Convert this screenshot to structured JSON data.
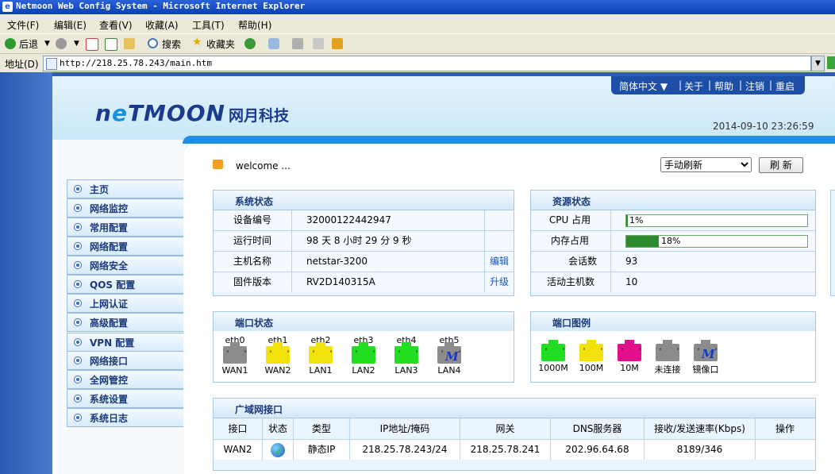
{
  "window": {
    "title": "Netmoon Web Config System - Microsoft Internet Explorer"
  },
  "menu": [
    "文件(F)",
    "编辑(E)",
    "查看(V)",
    "收藏(A)",
    "工具(T)",
    "帮助(H)"
  ],
  "toolbar": {
    "back": "后退",
    "search": "搜索",
    "favorites": "收藏夹"
  },
  "address": {
    "label": "地址(D)",
    "url": "http://218.25.78.243/main.htm"
  },
  "brand": {
    "logo_en_a": "n",
    "logo_en_b": "e",
    "logo_en_c": "TMOON",
    "logo_cn": "网月科技"
  },
  "topnav": [
    "简体中文 ▼",
    "关于",
    "帮助",
    "注销",
    "重启"
  ],
  "datetime": "2014-09-10 23:26:59",
  "welcome": "welcome ...",
  "refresh": {
    "mode": "手动刷新",
    "button": "刷 新"
  },
  "sidebar": [
    "主页",
    "网络监控",
    "常用配置",
    "网络配置",
    "网络安全",
    "QOS 配置",
    "上网认证",
    "高级配置",
    "VPN 配置",
    "网络接口",
    "全网管控",
    "系统设置",
    "系统日志"
  ],
  "system_status": {
    "title": "系统状态",
    "rows": [
      {
        "label": "设备编号",
        "value": "32000122442947",
        "action": ""
      },
      {
        "label": "运行时间",
        "value": "98 天  8 小时  29 分  9 秒",
        "action": ""
      },
      {
        "label": "主机名称",
        "value": "netstar-3200",
        "action": "编辑"
      },
      {
        "label": "固件版本",
        "value": "RV2D140315A",
        "action": "升级"
      }
    ]
  },
  "resource_status": {
    "title": "资源状态",
    "cpu": {
      "label": "CPU 占用",
      "percent": 1,
      "text": "1%"
    },
    "mem": {
      "label": "内存占用",
      "percent": 18,
      "text": "18%"
    },
    "sessions": {
      "label": "会话数",
      "value": "93"
    },
    "hosts": {
      "label": "活动主机数",
      "value": "10"
    }
  },
  "port_status": {
    "title": "端口状态",
    "ports": [
      {
        "name": "eth0",
        "role": "WAN1",
        "state": "未连接",
        "color": "#8c8c8c"
      },
      {
        "name": "eth1",
        "role": "WAN2",
        "state": "100M",
        "color": "#f0e20a"
      },
      {
        "name": "eth2",
        "role": "LAN1",
        "state": "100M",
        "color": "#f0e20a"
      },
      {
        "name": "eth3",
        "role": "LAN2",
        "state": "1000M",
        "color": "#22dd22"
      },
      {
        "name": "eth4",
        "role": "LAN3",
        "state": "1000M",
        "color": "#22dd22"
      },
      {
        "name": "eth5",
        "role": "LAN4",
        "state": "镜像口",
        "color": "#8c8c8c"
      }
    ]
  },
  "port_legend": {
    "title": "端口图例",
    "items": [
      {
        "label": "1000M",
        "color": "#22dd22"
      },
      {
        "label": "100M",
        "color": "#f0e20a"
      },
      {
        "label": "10M",
        "color": "#e0108a"
      },
      {
        "label": "未连接",
        "color": "#8c8c8c"
      },
      {
        "label": "镜像口",
        "color": "#8c8c8c"
      }
    ]
  },
  "wan": {
    "title": "广域网接口",
    "columns": [
      "接口",
      "状态",
      "类型",
      "IP地址/掩码",
      "网关",
      "DNS服务器",
      "接收/发送速率(Kbps)",
      "操作"
    ],
    "rows": [
      {
        "iface": "WAN2",
        "status": "connected",
        "type": "静态IP",
        "ip": "218.25.78.243/24",
        "gateway": "218.25.78.241",
        "dns": "202.96.64.68",
        "rate": "8189/346",
        "op": ""
      }
    ]
  }
}
